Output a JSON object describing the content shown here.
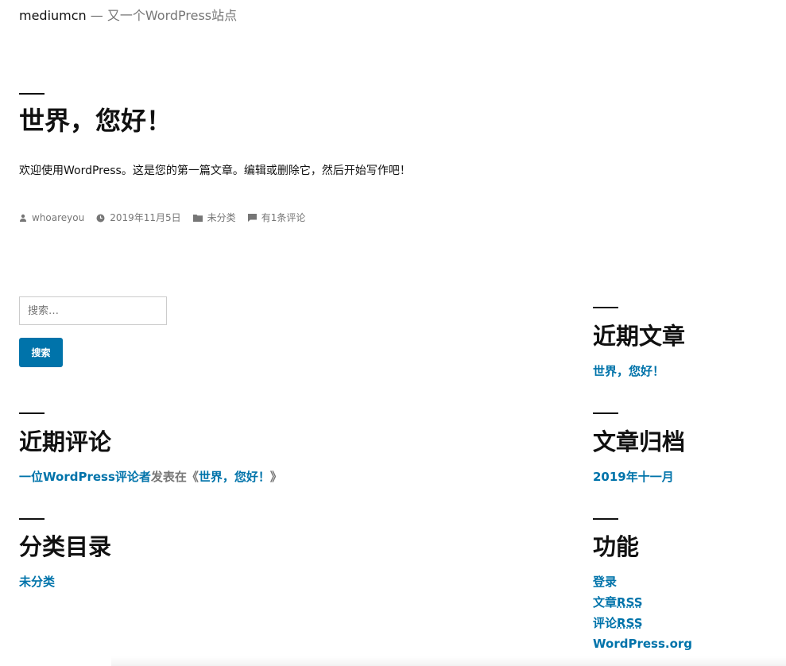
{
  "site": {
    "title": "mediumcn",
    "separator": "—",
    "description": "又一个WordPress站点"
  },
  "post": {
    "title": "世界，您好！",
    "content": "欢迎使用WordPress。这是您的第一篇文章。编辑或删除它，然后开始写作吧！",
    "meta": {
      "author": "whoareyou",
      "date": "2019年11月5日",
      "category": "未分类",
      "comments": "有1条评论"
    }
  },
  "search": {
    "placeholder": "搜索…",
    "button_label": "搜索"
  },
  "widgets": {
    "recent_posts": {
      "title": "近期文章",
      "items": [
        "世界，您好！"
      ]
    },
    "recent_comments": {
      "title": "近期评论",
      "author": "一位WordPress评论者",
      "connector": "发表在《",
      "post": "世界，您好！",
      "close": "》"
    },
    "archives": {
      "title": "文章归档",
      "items": [
        "2019年十一月"
      ]
    },
    "categories": {
      "title": "分类目录",
      "items": [
        "未分类"
      ]
    },
    "meta": {
      "title": "功能",
      "login": "登录",
      "entries_prefix": "文章",
      "comments_prefix": "评论",
      "rss": "RSS",
      "wordpress_org": "WordPress.org"
    }
  },
  "colors": {
    "link": "#0073aa",
    "text": "#111111",
    "muted": "#767676"
  }
}
